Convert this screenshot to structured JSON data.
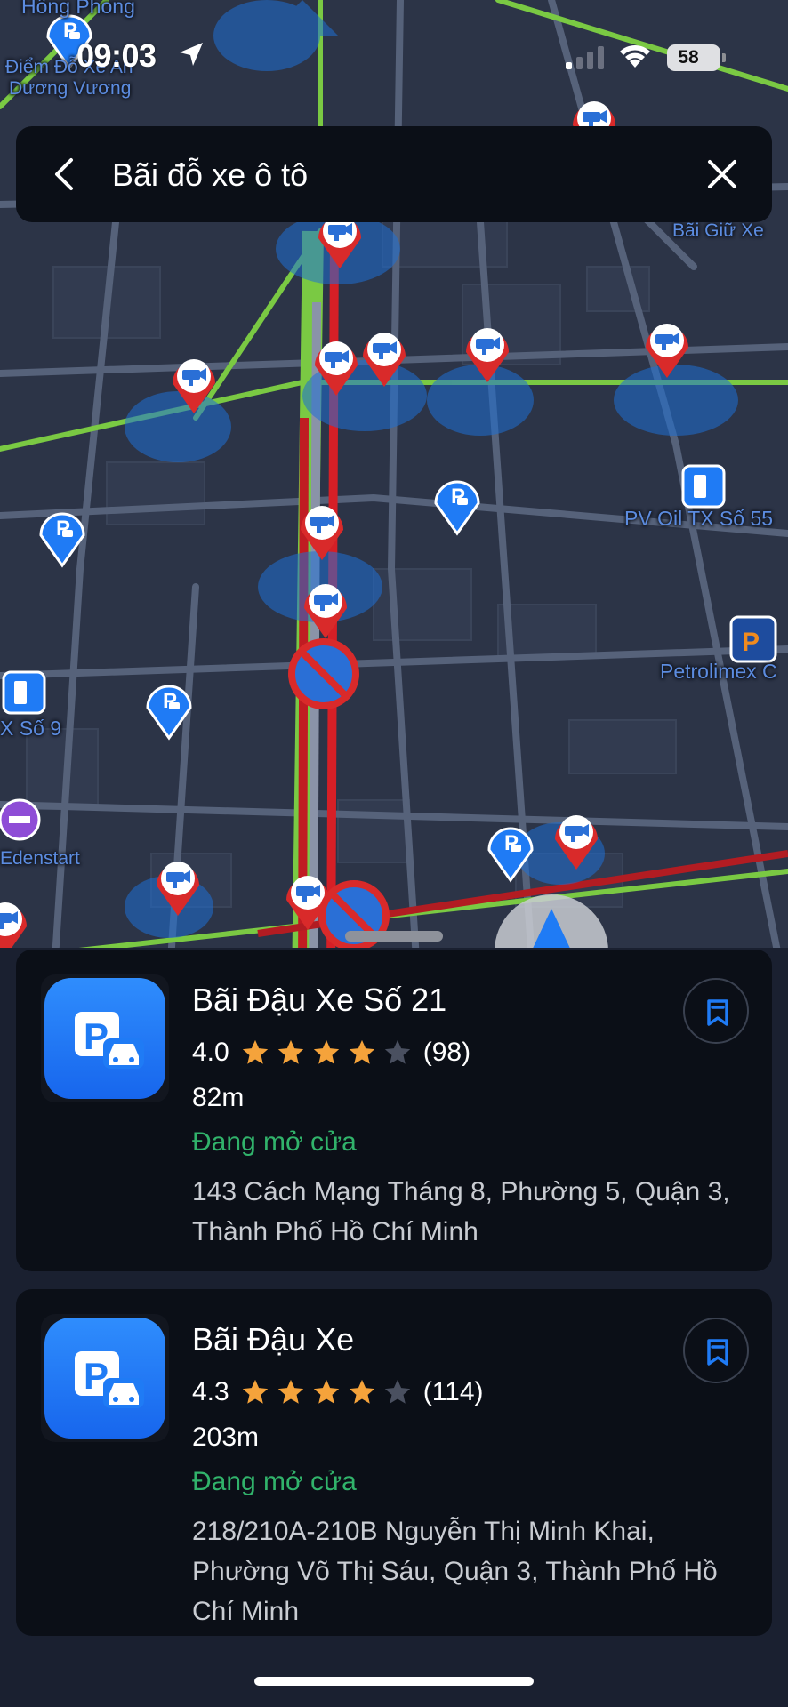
{
  "status_bar": {
    "time": "09:03",
    "battery": "58"
  },
  "search": {
    "query": "Bãi đỗ xe ô tô"
  },
  "map": {
    "labels": {
      "top_left_1": "Hồng Phong",
      "top_left_2": "Điểm Đỗ Xe An",
      "top_left_3": "Dương Vương",
      "top_right": "Bãi Giữ Xe",
      "gas_1": "PV Oil TX Số 55",
      "gas_2": "Petrolimex C",
      "gas_3": "X Số 9",
      "hotel": "Edenstart"
    }
  },
  "results": [
    {
      "title": "Bãi Đậu Xe Số 21",
      "rating": "4.0",
      "stars": 4,
      "reviews": "(98)",
      "distance": "82m",
      "status": "Đang mở cửa",
      "address": "143 Cách Mạng Tháng 8, Phường 5, Quận 3, Thành Phố Hồ Chí Minh"
    },
    {
      "title": "Bãi Đậu Xe",
      "rating": "4.3",
      "stars": 4,
      "reviews": "(114)",
      "distance": "203m",
      "status": "Đang mở cửa",
      "address": "218/210A-210B Nguyễn Thị Minh Khai, Phường Võ Thị Sáu, Quận 3, Thành Phố Hồ Chí Minh"
    }
  ],
  "colors": {
    "accent_blue": "#1f7bf5",
    "open_green": "#31b36b",
    "star_orange": "#f5a33b",
    "star_empty": "#4a5060",
    "card_bg": "#0b0f17"
  },
  "icons": [
    "location-arrow-icon",
    "signal-icon",
    "wifi-icon",
    "battery-icon",
    "back-icon",
    "close-icon",
    "parking-icon",
    "bookmark-icon",
    "star-icon",
    "camera-marker-icon",
    "no-parking-sign-icon",
    "gas-station-icon",
    "hotel-icon",
    "navigation-arrow-icon"
  ]
}
